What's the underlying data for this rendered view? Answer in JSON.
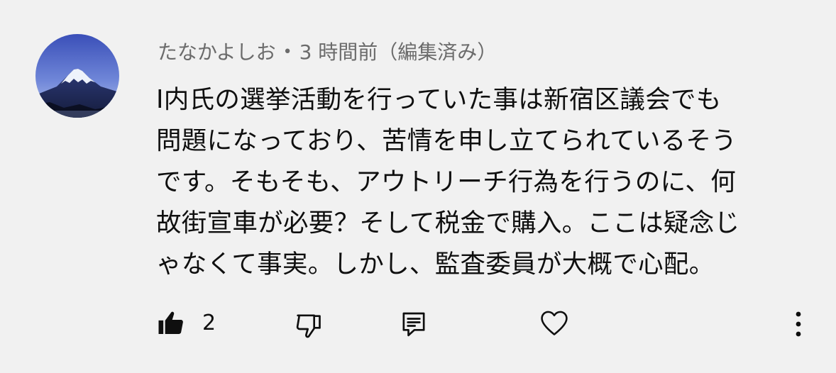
{
  "comment": {
    "author": "たなかよしお",
    "separator": "•",
    "meta": "3 時間前（編集済み）",
    "lines": [
      "I内氏の選挙活動を行っていた事は新宿区議会でも",
      "問題になっており、苦情を申し立てられているそう",
      "です。そもそも、アウトリーチ行為を行うのに、何",
      "故街宣車が必要？そして税金で購入。ここは疑念じ",
      "ゃなくて事実。しかし、監査委員が大概で心配。"
    ],
    "like_count": "2"
  },
  "icons": {
    "like": "thumbs-up-filled-icon",
    "dislike": "thumbs-down-outline-icon",
    "reply": "reply-comment-icon",
    "heart": "heart-outline-icon",
    "more": "more-vertical-icon"
  },
  "colors": {
    "background": "#f1f1f1",
    "text": "#0f0f0f",
    "meta_text": "#6b6b6b"
  }
}
